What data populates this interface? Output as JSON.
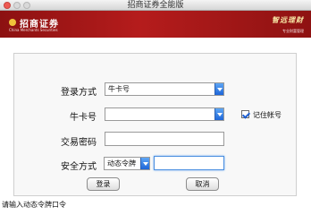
{
  "window": {
    "title": "招商证券全能版"
  },
  "banner": {
    "brand_name": "招商证券",
    "brand_en": "China Merchants Securities",
    "ad_badge": "智远理财",
    "ad_sub": "专业财富管理"
  },
  "form": {
    "login_mode": {
      "label": "登录方式",
      "value": "牛卡号"
    },
    "card_number": {
      "label": "牛卡号",
      "value": ""
    },
    "password": {
      "label": "交易密码",
      "value": ""
    },
    "security": {
      "label": "安全方式",
      "mode_value": "动态令牌",
      "code_value": ""
    },
    "remember": {
      "label": "记住帐号",
      "checked": true
    }
  },
  "buttons": {
    "login_label": "登录",
    "cancel_label": "取消"
  },
  "status": {
    "message": "请输入动态令牌口令"
  },
  "colors": {
    "banner_red": "#b51c1c",
    "accent_blue": "#1e66d8"
  }
}
